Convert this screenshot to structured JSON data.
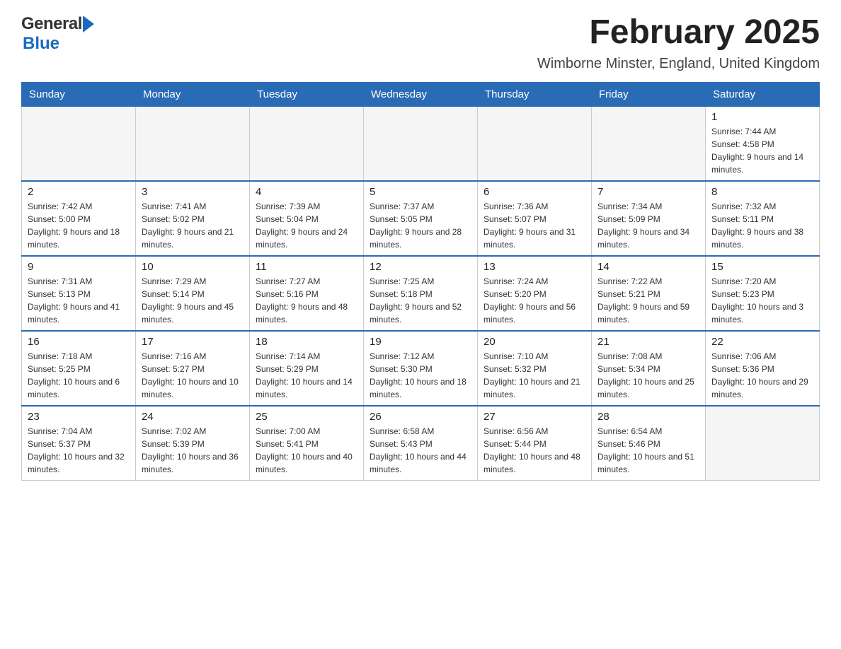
{
  "header": {
    "logo_general": "General",
    "logo_blue": "Blue",
    "title": "February 2025",
    "subtitle": "Wimborne Minster, England, United Kingdom"
  },
  "days_of_week": [
    "Sunday",
    "Monday",
    "Tuesday",
    "Wednesday",
    "Thursday",
    "Friday",
    "Saturday"
  ],
  "weeks": [
    {
      "days": [
        {
          "number": "",
          "info": ""
        },
        {
          "number": "",
          "info": ""
        },
        {
          "number": "",
          "info": ""
        },
        {
          "number": "",
          "info": ""
        },
        {
          "number": "",
          "info": ""
        },
        {
          "number": "",
          "info": ""
        },
        {
          "number": "1",
          "info": "Sunrise: 7:44 AM\nSunset: 4:58 PM\nDaylight: 9 hours and 14 minutes."
        }
      ]
    },
    {
      "days": [
        {
          "number": "2",
          "info": "Sunrise: 7:42 AM\nSunset: 5:00 PM\nDaylight: 9 hours and 18 minutes."
        },
        {
          "number": "3",
          "info": "Sunrise: 7:41 AM\nSunset: 5:02 PM\nDaylight: 9 hours and 21 minutes."
        },
        {
          "number": "4",
          "info": "Sunrise: 7:39 AM\nSunset: 5:04 PM\nDaylight: 9 hours and 24 minutes."
        },
        {
          "number": "5",
          "info": "Sunrise: 7:37 AM\nSunset: 5:05 PM\nDaylight: 9 hours and 28 minutes."
        },
        {
          "number": "6",
          "info": "Sunrise: 7:36 AM\nSunset: 5:07 PM\nDaylight: 9 hours and 31 minutes."
        },
        {
          "number": "7",
          "info": "Sunrise: 7:34 AM\nSunset: 5:09 PM\nDaylight: 9 hours and 34 minutes."
        },
        {
          "number": "8",
          "info": "Sunrise: 7:32 AM\nSunset: 5:11 PM\nDaylight: 9 hours and 38 minutes."
        }
      ]
    },
    {
      "days": [
        {
          "number": "9",
          "info": "Sunrise: 7:31 AM\nSunset: 5:13 PM\nDaylight: 9 hours and 41 minutes."
        },
        {
          "number": "10",
          "info": "Sunrise: 7:29 AM\nSunset: 5:14 PM\nDaylight: 9 hours and 45 minutes."
        },
        {
          "number": "11",
          "info": "Sunrise: 7:27 AM\nSunset: 5:16 PM\nDaylight: 9 hours and 48 minutes."
        },
        {
          "number": "12",
          "info": "Sunrise: 7:25 AM\nSunset: 5:18 PM\nDaylight: 9 hours and 52 minutes."
        },
        {
          "number": "13",
          "info": "Sunrise: 7:24 AM\nSunset: 5:20 PM\nDaylight: 9 hours and 56 minutes."
        },
        {
          "number": "14",
          "info": "Sunrise: 7:22 AM\nSunset: 5:21 PM\nDaylight: 9 hours and 59 minutes."
        },
        {
          "number": "15",
          "info": "Sunrise: 7:20 AM\nSunset: 5:23 PM\nDaylight: 10 hours and 3 minutes."
        }
      ]
    },
    {
      "days": [
        {
          "number": "16",
          "info": "Sunrise: 7:18 AM\nSunset: 5:25 PM\nDaylight: 10 hours and 6 minutes."
        },
        {
          "number": "17",
          "info": "Sunrise: 7:16 AM\nSunset: 5:27 PM\nDaylight: 10 hours and 10 minutes."
        },
        {
          "number": "18",
          "info": "Sunrise: 7:14 AM\nSunset: 5:29 PM\nDaylight: 10 hours and 14 minutes."
        },
        {
          "number": "19",
          "info": "Sunrise: 7:12 AM\nSunset: 5:30 PM\nDaylight: 10 hours and 18 minutes."
        },
        {
          "number": "20",
          "info": "Sunrise: 7:10 AM\nSunset: 5:32 PM\nDaylight: 10 hours and 21 minutes."
        },
        {
          "number": "21",
          "info": "Sunrise: 7:08 AM\nSunset: 5:34 PM\nDaylight: 10 hours and 25 minutes."
        },
        {
          "number": "22",
          "info": "Sunrise: 7:06 AM\nSunset: 5:36 PM\nDaylight: 10 hours and 29 minutes."
        }
      ]
    },
    {
      "days": [
        {
          "number": "23",
          "info": "Sunrise: 7:04 AM\nSunset: 5:37 PM\nDaylight: 10 hours and 32 minutes."
        },
        {
          "number": "24",
          "info": "Sunrise: 7:02 AM\nSunset: 5:39 PM\nDaylight: 10 hours and 36 minutes."
        },
        {
          "number": "25",
          "info": "Sunrise: 7:00 AM\nSunset: 5:41 PM\nDaylight: 10 hours and 40 minutes."
        },
        {
          "number": "26",
          "info": "Sunrise: 6:58 AM\nSunset: 5:43 PM\nDaylight: 10 hours and 44 minutes."
        },
        {
          "number": "27",
          "info": "Sunrise: 6:56 AM\nSunset: 5:44 PM\nDaylight: 10 hours and 48 minutes."
        },
        {
          "number": "28",
          "info": "Sunrise: 6:54 AM\nSunset: 5:46 PM\nDaylight: 10 hours and 51 minutes."
        },
        {
          "number": "",
          "info": ""
        }
      ]
    }
  ]
}
